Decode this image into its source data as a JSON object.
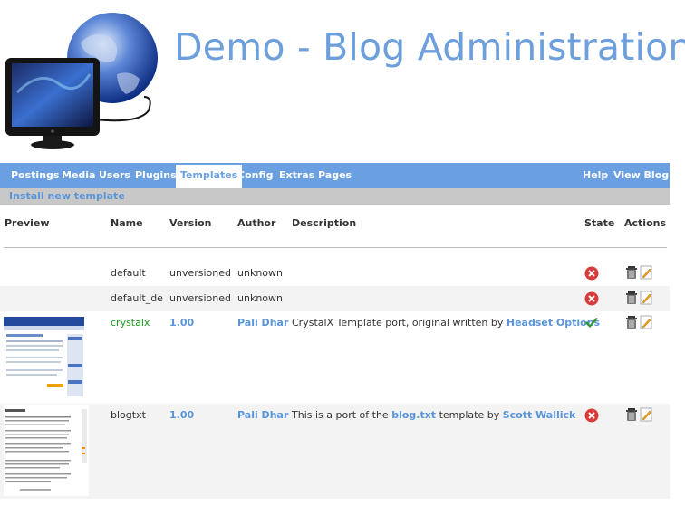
{
  "header": {
    "title": "Demo - Blog Administration",
    "logo": "monitor-globe-logo"
  },
  "nav": {
    "items": [
      {
        "label": "Postings",
        "active": false
      },
      {
        "label": "Media",
        "active": false
      },
      {
        "label": "Users",
        "active": false
      },
      {
        "label": "Plugins",
        "active": false
      },
      {
        "label": "Templates",
        "active": true
      },
      {
        "label": "Config",
        "active": false
      },
      {
        "label": "Extras",
        "active": false
      },
      {
        "label": "Pages",
        "active": false
      }
    ],
    "right_items": [
      {
        "label": "Help"
      },
      {
        "label": "View Blog"
      }
    ]
  },
  "subnav": {
    "install_label": "Install new template"
  },
  "table": {
    "columns": {
      "preview": "Preview",
      "name": "Name",
      "version": "Version",
      "author": "Author",
      "description": "Description",
      "state": "State",
      "actions": "Actions"
    },
    "rows": [
      {
        "name": "default",
        "version": "unversioned",
        "author": "unknown",
        "description": "",
        "state": "disabled",
        "has_preview": false
      },
      {
        "name": "default_de",
        "version": "unversioned",
        "author": "unknown",
        "description": "",
        "state": "disabled",
        "has_preview": false
      },
      {
        "name": "crystalx",
        "version": "1.00",
        "author": "Pali Dhar",
        "description_prefix": "CrystalX Template port, original written by ",
        "description_link": "Headset Options",
        "state": "enabled",
        "has_preview": true
      },
      {
        "name": "blogtxt",
        "version": "1.00",
        "author": "Pali Dhar",
        "description_prefix": "This is a port of the ",
        "description_link": "blog.txt",
        "description_middle": " template by ",
        "description_link2": "Scott Wallick",
        "state": "disabled",
        "has_preview": true
      }
    ]
  },
  "icons": {
    "disabled_state": "red-x-circle-icon",
    "enabled_state": "green-check-icon",
    "delete_action": "trash-can-icon",
    "edit_action": "edit-pencil-icon"
  },
  "colors": {
    "accent_blue": "#6aa0e2",
    "link_blue": "#5b95d8",
    "active_green": "#1c9a1c",
    "subbar_gray": "#c8c8c8"
  }
}
